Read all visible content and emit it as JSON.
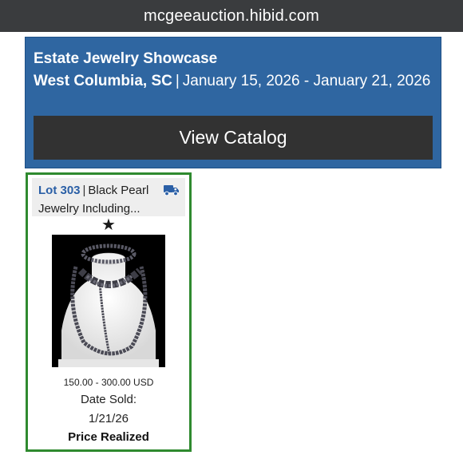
{
  "browser": {
    "url": "mcgeeauction.hibid.com"
  },
  "auction": {
    "title": "Estate Jewelry Showcase",
    "location": "West Columbia, SC",
    "separator": "|",
    "dates": "January 15, 2026 - January 21, 2026",
    "view_catalog_label": "View Catalog",
    "header_color": "#2f66a1"
  },
  "lot": {
    "number": "Lot 303",
    "separator": "|",
    "title": "Black Pearl Jewelry Including...",
    "shipping_icon": "truck-icon",
    "favorite_icon": "star-icon",
    "favorite_glyph": "★",
    "image_icon": "pearl-jewelry-photo",
    "estimate": "150.00 - 300.00 USD",
    "date_sold_label": "Date Sold:",
    "date_sold": "1/21/26",
    "status": "Price Realized",
    "border_color": "#2f8a2f"
  }
}
